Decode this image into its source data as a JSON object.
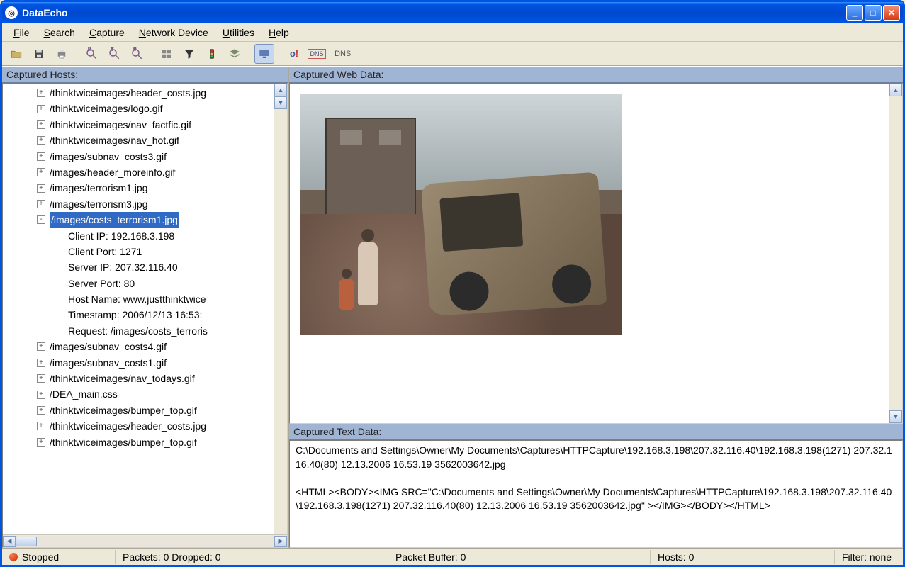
{
  "window": {
    "title": "DataEcho"
  },
  "menu": {
    "file": "File",
    "search": "Search",
    "capture": "Capture",
    "network": "Network Device",
    "utilities": "Utilities",
    "help": "Help"
  },
  "toolbar": {
    "open": "open-icon",
    "save": "save-icon",
    "print": "print-icon",
    "zoom1": "magnifier-icon",
    "zoom2": "magnifier-t-icon",
    "zoom3": "magnifier-s-icon",
    "grid": "grid-icon",
    "filter": "funnel-icon",
    "traffic": "traffic-light-icon",
    "layers": "layers-icon",
    "monitor": "monitor-icon",
    "alert": "alert-icon",
    "dns_icon": "dns-icon",
    "dns_label": "DNS"
  },
  "panels": {
    "hosts_header": "Captured Hosts:",
    "web_header": "Captured Web Data:",
    "text_header": "Captured Text Data:"
  },
  "tree": {
    "items": [
      {
        "expand": "+",
        "label": "/thinktwiceimages/header_costs.jpg"
      },
      {
        "expand": "+",
        "label": "/thinktwiceimages/logo.gif"
      },
      {
        "expand": "+",
        "label": "/thinktwiceimages/nav_factfic.gif"
      },
      {
        "expand": "+",
        "label": "/thinktwiceimages/nav_hot.gif"
      },
      {
        "expand": "+",
        "label": "/images/subnav_costs3.gif"
      },
      {
        "expand": "+",
        "label": "/images/header_moreinfo.gif"
      },
      {
        "expand": "+",
        "label": "/images/terrorism1.jpg"
      },
      {
        "expand": "+",
        "label": "/images/terrorism3.jpg"
      },
      {
        "expand": "-",
        "label": "/images/costs_terrorism1.jpg",
        "selected": true,
        "details": [
          "Client IP: 192.168.3.198",
          "Client Port: 1271",
          "Server IP: 207.32.116.40",
          "Server Port: 80",
          "Host Name: www.justthinktwice",
          "Timestamp: 2006/12/13 16:53:",
          "Request: /images/costs_terroris"
        ]
      },
      {
        "expand": "+",
        "label": "/images/subnav_costs4.gif"
      },
      {
        "expand": "+",
        "label": "/images/subnav_costs1.gif"
      },
      {
        "expand": "+",
        "label": "/thinktwiceimages/nav_todays.gif"
      },
      {
        "expand": "+",
        "label": "/DEA_main.css"
      },
      {
        "expand": "+",
        "label": "/thinktwiceimages/bumper_top.gif"
      },
      {
        "expand": "+",
        "label": "/thinktwiceimages/header_costs.jpg"
      },
      {
        "expand": "+",
        "label": "/thinktwiceimages/bumper_top.gif"
      }
    ]
  },
  "text_data": {
    "line1": "C:\\Documents and Settings\\Owner\\My Documents\\Captures\\HTTPCapture\\192.168.3.198\\207.32.116.40\\192.168.3.198(1271) 207.32.116.40(80) 12.13.2006 16.53.19 3562003642.jpg",
    "line2": "<HTML><BODY><IMG SRC=\"C:\\Documents and Settings\\Owner\\My Documents\\Captures\\HTTPCapture\\192.168.3.198\\207.32.116.40\\192.168.3.198(1271) 207.32.116.40(80) 12.13.2006 16.53.19 3562003642.jpg\" ></IMG></BODY></HTML>"
  },
  "status": {
    "state": "Stopped",
    "packets": "Packets: 0 Dropped: 0",
    "buffer": "Packet Buffer: 0",
    "hosts": "Hosts: 0",
    "filter": "Filter: none"
  }
}
